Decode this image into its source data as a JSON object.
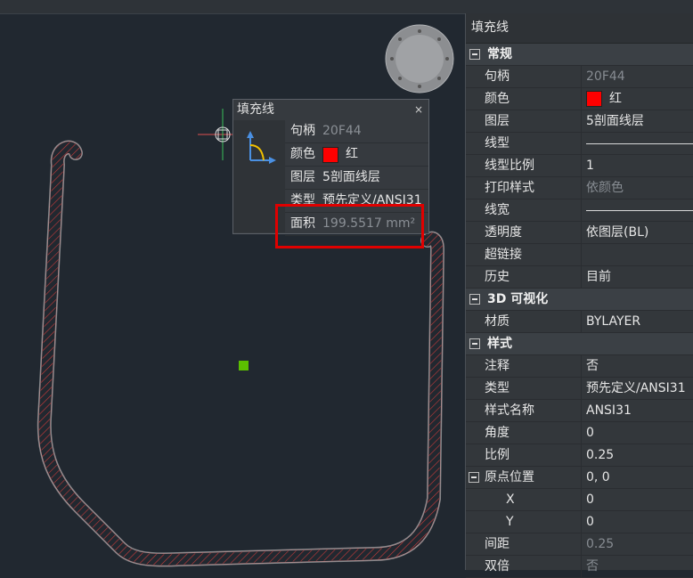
{
  "quick_props": {
    "title": "填充线",
    "close": "×",
    "rows": [
      {
        "key": "句柄",
        "value": "20F44"
      },
      {
        "key": "颜色",
        "value": "红"
      },
      {
        "key": "图层",
        "value": "5剖面线层"
      },
      {
        "key": "类型",
        "value": "预先定义/ANSI31"
      },
      {
        "key": "面积",
        "value": "199.5517 mm²"
      }
    ]
  },
  "panel": {
    "title": "填充线",
    "sections": {
      "general": "常规",
      "viz3d": "3D 可视化",
      "style": "样式"
    },
    "rows": {
      "handle": {
        "key": "句柄",
        "value": "20F44"
      },
      "color": {
        "key": "颜色",
        "value": "红"
      },
      "layer": {
        "key": "图层",
        "value": "5剖面线层"
      },
      "linetype": {
        "key": "线型"
      },
      "ltscale": {
        "key": "线型比例",
        "value": "1"
      },
      "plotstyle": {
        "key": "打印样式",
        "value": "依颜色"
      },
      "lineweight": {
        "key": "线宽"
      },
      "transparency": {
        "key": "透明度",
        "value": "依图层(BL)"
      },
      "hyperlink": {
        "key": "超链接",
        "value": ""
      },
      "history": {
        "key": "历史",
        "value": "目前"
      },
      "material": {
        "key": "材质",
        "value": "BYLAYER"
      },
      "annotative": {
        "key": "注释",
        "value": "否"
      },
      "type": {
        "key": "类型",
        "value": "预先定义/ANSI31"
      },
      "pattern": {
        "key": "样式名称",
        "value": "ANSI31"
      },
      "angle": {
        "key": "角度",
        "value": "0"
      },
      "scale": {
        "key": "比例",
        "value": "0.25"
      },
      "origin": {
        "key": "原点位置",
        "value": "0, 0"
      },
      "ox": {
        "key": "X",
        "value": "0"
      },
      "oy": {
        "key": "Y",
        "value": "0"
      },
      "spacing": {
        "key": "间距",
        "value": "0.25"
      },
      "double": {
        "key": "双倍",
        "value": "否"
      }
    }
  },
  "colors": {
    "background": "#212830",
    "hatch": "#c83a3a",
    "accent": "#ff0000",
    "grip": "#5cc000",
    "highlight": "#e00000"
  },
  "icons": [
    "close-icon",
    "hatch-type-icon",
    "view-cube-icon",
    "collapse-icon"
  ]
}
